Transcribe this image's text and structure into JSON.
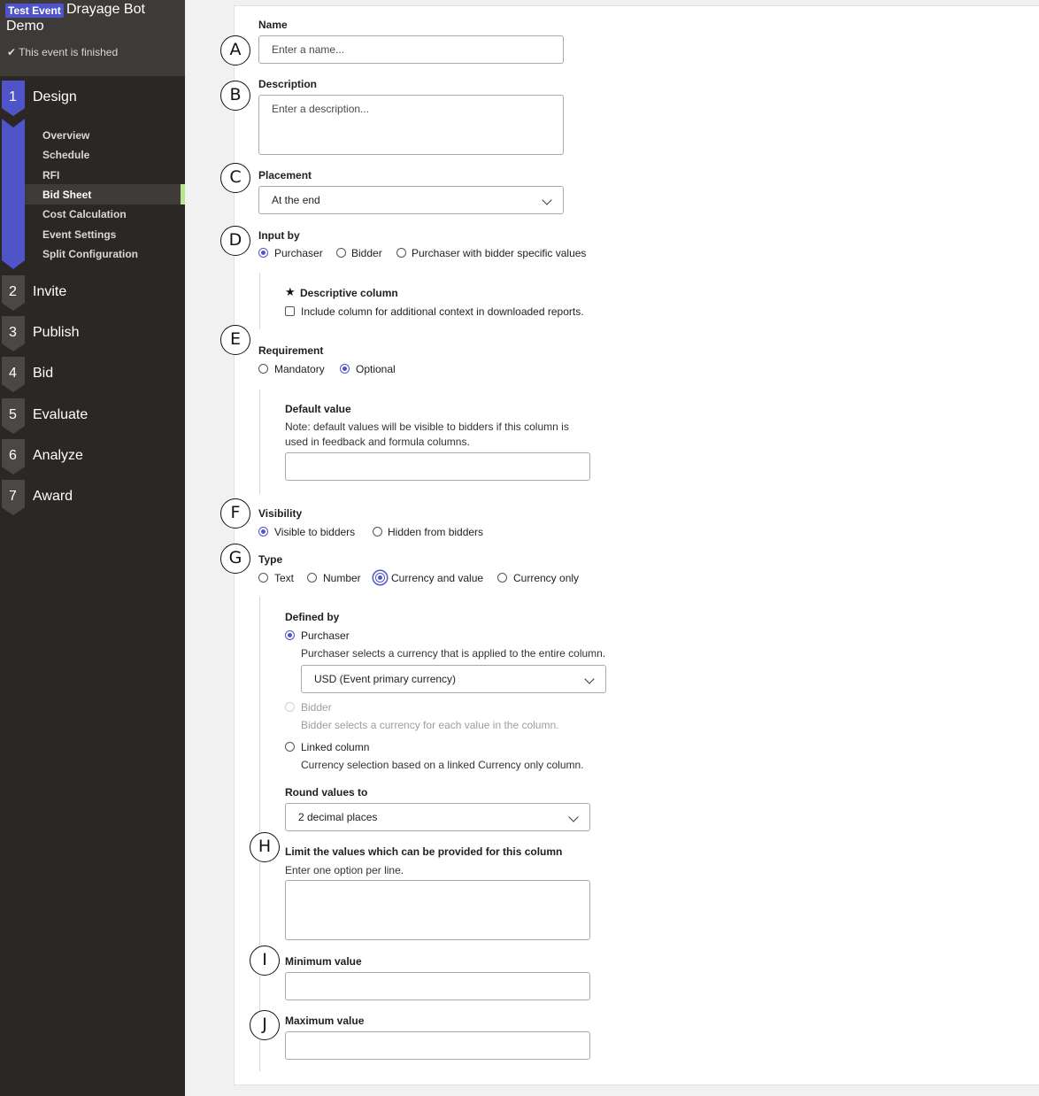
{
  "sidebar": {
    "badge": "Test Event",
    "title_line1": "Drayage Bot",
    "title_line2": "Demo",
    "status": "This event is finished",
    "steps": [
      {
        "num": "1",
        "label": "Design"
      },
      {
        "num": "2",
        "label": "Invite"
      },
      {
        "num": "3",
        "label": "Publish"
      },
      {
        "num": "4",
        "label": "Bid"
      },
      {
        "num": "5",
        "label": "Evaluate"
      },
      {
        "num": "6",
        "label": "Analyze"
      },
      {
        "num": "7",
        "label": "Award"
      }
    ],
    "design_items": [
      "Overview",
      "Schedule",
      "RFI",
      "Bid Sheet",
      "Cost Calculation",
      "Event Settings",
      "Split Configuration"
    ],
    "active_item": "Bid Sheet"
  },
  "markers": [
    "A",
    "B",
    "C",
    "D",
    "E",
    "F",
    "G",
    "H",
    "I",
    "J"
  ],
  "form": {
    "name": {
      "label": "Name",
      "placeholder": "Enter a name..."
    },
    "description": {
      "label": "Description",
      "placeholder": "Enter a description..."
    },
    "placement": {
      "label": "Placement",
      "value": "At the end"
    },
    "input_by": {
      "label": "Input by",
      "options": [
        "Purchaser",
        "Bidder",
        "Purchaser with bidder specific values"
      ],
      "selected": "Purchaser"
    },
    "descriptive_column": {
      "label": "Descriptive column",
      "checkbox_label": "Include column for additional context in downloaded reports.",
      "checked": false
    },
    "requirement": {
      "label": "Requirement",
      "options": [
        "Mandatory",
        "Optional"
      ],
      "selected": "Optional"
    },
    "default_value": {
      "label": "Default value",
      "note_line1": "Note: default values will be visible to bidders if this column is",
      "note_line2": "used in feedback and formula columns.",
      "value": ""
    },
    "visibility": {
      "label": "Visibility",
      "options": [
        "Visible to bidders",
        "Hidden from bidders"
      ],
      "selected": "Visible to bidders"
    },
    "type": {
      "label": "Type",
      "options": [
        "Text",
        "Number",
        "Currency and value",
        "Currency only"
      ],
      "selected": "Currency and value"
    },
    "defined_by": {
      "label": "Defined by",
      "purchaser": {
        "label": "Purchaser",
        "help": "Purchaser selects a currency that is applied to the entire column.",
        "selected": true
      },
      "currency_select": "USD (Event primary currency)",
      "bidder": {
        "label": "Bidder",
        "help": "Bidder selects a currency for each value in the column.",
        "disabled": true
      },
      "linked": {
        "label": "Linked column",
        "help": "Currency selection based on a linked Currency only column."
      }
    },
    "round_values": {
      "label": "Round values to",
      "value": "2 decimal places"
    },
    "limit_values": {
      "label": "Limit the values which can be provided for this column",
      "help": "Enter one option per line.",
      "value": ""
    },
    "minimum": {
      "label": "Minimum value",
      "value": ""
    },
    "maximum": {
      "label": "Maximum value",
      "value": ""
    }
  }
}
